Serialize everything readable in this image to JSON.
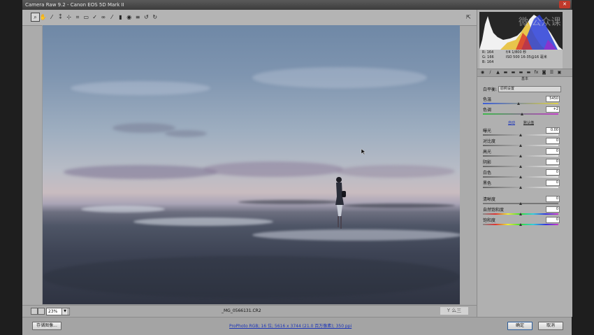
{
  "window": {
    "title": "Camera Raw 9.2 - Canon EOS 5D Mark II",
    "close_label": "✕"
  },
  "toolbar": {
    "tools": [
      {
        "name": "zoom-tool-icon",
        "glyph": "⌕"
      },
      {
        "name": "hand-tool-icon",
        "glyph": "✋"
      },
      {
        "name": "white-balance-tool-icon",
        "glyph": "⁄"
      },
      {
        "name": "color-sampler-tool-icon",
        "glyph": "⁑"
      },
      {
        "name": "targeted-adjustment-tool-icon",
        "glyph": "⊹"
      },
      {
        "name": "crop-tool-icon",
        "glyph": "⌗"
      },
      {
        "name": "straighten-tool-icon",
        "glyph": "▭"
      },
      {
        "name": "spot-removal-tool-icon",
        "glyph": "✓"
      },
      {
        "name": "red-eye-tool-icon",
        "glyph": "∞"
      },
      {
        "name": "adjustment-brush-icon",
        "glyph": "⁄"
      },
      {
        "name": "graduated-filter-icon",
        "glyph": "▮"
      },
      {
        "name": "radial-filter-icon",
        "glyph": "◉"
      },
      {
        "name": "preferences-icon",
        "glyph": "≡"
      },
      {
        "name": "rotate-ccw-icon",
        "glyph": "↺"
      },
      {
        "name": "rotate-cw-icon",
        "glyph": "↻"
      }
    ],
    "fullscreen_glyph": "⇱"
  },
  "status": {
    "zoom": "23%",
    "zoom_arrow": "▼",
    "filename": "_MG_0566131.CR2",
    "watermark": "Y 么三"
  },
  "bottom": {
    "save_label": "存储图像...",
    "workflow_link": "ProPhoto RGB; 16 位; 5616 x 3744 (21.0 百万像素); 350 ppi",
    "done_label": "确定",
    "cancel_label": "取消"
  },
  "histogram_overlay": "微 公众课",
  "info": {
    "r": "R:  164",
    "g": "G:  166",
    "b": "B:  164",
    "exif1": "f/4   1/800 秒",
    "exif2": "ISO 500   16-35@16 毫米"
  },
  "panel": {
    "title": "基本",
    "wb_label": "白平衡:",
    "wb_value": "原照设置",
    "auto": "自动",
    "default": "默认值"
  },
  "sliders": [
    {
      "label": "色温",
      "value": "5450",
      "pos": 0.47
    },
    {
      "label": "色调",
      "value": "+2",
      "pos": 0.52
    },
    {
      "label": "曝光",
      "value": "0.00",
      "pos": 0.5
    },
    {
      "label": "对比度",
      "value": "0",
      "pos": 0.5
    },
    {
      "label": "高光",
      "value": "0",
      "pos": 0.5
    },
    {
      "label": "阴影",
      "value": "0",
      "pos": 0.5
    },
    {
      "label": "白色",
      "value": "0",
      "pos": 0.5
    },
    {
      "label": "黑色",
      "value": "0",
      "pos": 0.5
    },
    {
      "label": "清晰度",
      "value": "0",
      "pos": 0.5
    },
    {
      "label": "自然饱和度",
      "value": "0",
      "pos": 0.5
    },
    {
      "label": "饱和度",
      "value": "0",
      "pos": 0.5
    }
  ],
  "colors": {
    "accent_link": "#1a33b8"
  }
}
